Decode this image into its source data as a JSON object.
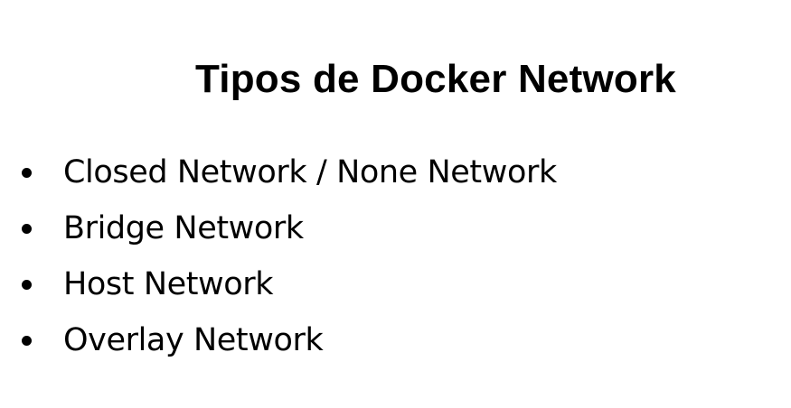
{
  "slide": {
    "title": "Tipos de Docker Network",
    "bullets": [
      {
        "label": "Closed Network / None Network"
      },
      {
        "label": "Bridge Network"
      },
      {
        "label": "Host Network"
      },
      {
        "label": "Overlay Network"
      }
    ]
  },
  "colors": {
    "background": "#ffffff",
    "text": "#000000"
  }
}
